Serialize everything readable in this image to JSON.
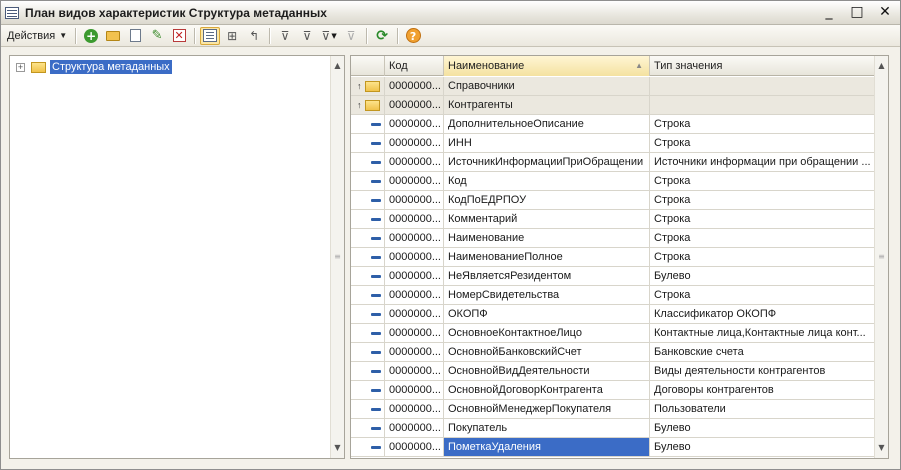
{
  "window": {
    "title": "План видов характеристик Структура метаданных",
    "controls": [
      "_",
      "□",
      "✕"
    ]
  },
  "toolbar": {
    "actions_label": "Действия",
    "buttons": [
      {
        "name": "add-icon",
        "glyph": "+"
      },
      {
        "name": "add-group-icon",
        "glyph": ""
      },
      {
        "name": "copy-icon",
        "glyph": ""
      },
      {
        "name": "edit-icon",
        "glyph": "✎"
      },
      {
        "name": "delete-icon",
        "glyph": "✕"
      },
      {
        "name": "list-mode-icon",
        "glyph": ""
      },
      {
        "name": "hierarchy-icon",
        "glyph": "⊞"
      },
      {
        "name": "level-up-icon",
        "glyph": "↰"
      },
      {
        "name": "filter-icon",
        "glyph": "⊽"
      },
      {
        "name": "filter-by-value-icon",
        "glyph": "⊽"
      },
      {
        "name": "filter-menu-icon",
        "glyph": "⊽"
      },
      {
        "name": "clear-filter-icon",
        "glyph": "⊽"
      },
      {
        "name": "refresh-icon",
        "glyph": "⟳"
      },
      {
        "name": "help-icon",
        "glyph": "?"
      }
    ]
  },
  "tree": {
    "items": [
      {
        "label": "Структура метаданных",
        "expand": "+"
      }
    ]
  },
  "grid": {
    "columns": {
      "code": "Код",
      "name": "Наименование",
      "type": "Тип значения",
      "sort_indicator": "▲"
    },
    "rows": [
      {
        "kind": "group",
        "code": "0000000...",
        "name": "Справочники",
        "type": ""
      },
      {
        "kind": "group",
        "code": "0000000...",
        "name": "Контрагенты",
        "type": ""
      },
      {
        "kind": "item",
        "code": "0000000...",
        "name": "ДополнительноеОписание",
        "type": "Строка"
      },
      {
        "kind": "item",
        "code": "0000000...",
        "name": "ИНН",
        "type": "Строка"
      },
      {
        "kind": "item",
        "code": "0000000...",
        "name": "ИсточникИнформацииПриОбращении",
        "type": "Источники информации при обращении ..."
      },
      {
        "kind": "item",
        "code": "0000000...",
        "name": "Код",
        "type": "Строка"
      },
      {
        "kind": "item",
        "code": "0000000...",
        "name": "КодПоЕДРПОУ",
        "type": "Строка"
      },
      {
        "kind": "item",
        "code": "0000000...",
        "name": "Комментарий",
        "type": "Строка"
      },
      {
        "kind": "item",
        "code": "0000000...",
        "name": "Наименование",
        "type": "Строка"
      },
      {
        "kind": "item",
        "code": "0000000...",
        "name": "НаименованиеПолное",
        "type": "Строка"
      },
      {
        "kind": "item",
        "code": "0000000...",
        "name": "НеЯвляетсяРезидентом",
        "type": "Булево"
      },
      {
        "kind": "item",
        "code": "0000000...",
        "name": "НомерСвидетельства",
        "type": "Строка"
      },
      {
        "kind": "item",
        "code": "0000000...",
        "name": "ОКОПФ",
        "type": "Классификатор ОКОПФ"
      },
      {
        "kind": "item",
        "code": "0000000...",
        "name": "ОсновноеКонтактноеЛицо",
        "type": "Контактные лица,Контактные лица конт..."
      },
      {
        "kind": "item",
        "code": "0000000...",
        "name": "ОсновнойБанковскийСчет",
        "type": "Банковские счета"
      },
      {
        "kind": "item",
        "code": "0000000...",
        "name": "ОсновнойВидДеятельности",
        "type": "Виды деятельности контрагентов"
      },
      {
        "kind": "item",
        "code": "0000000...",
        "name": "ОсновнойДоговорКонтрагента",
        "type": "Договоры контрагентов"
      },
      {
        "kind": "item",
        "code": "0000000...",
        "name": "ОсновнойМенеджерПокупателя",
        "type": "Пользователи"
      },
      {
        "kind": "item",
        "code": "0000000...",
        "name": "Покупатель",
        "type": "Булево"
      },
      {
        "kind": "item",
        "code": "0000000...",
        "name": "ПометкаУдаления",
        "type": "Булево",
        "selected": true
      }
    ]
  },
  "scroll": {
    "up": "▲",
    "down": "▼",
    "mid": "≡"
  },
  "colors": {
    "selection": "#3b6cc6",
    "group_row": "#ebe8df"
  }
}
